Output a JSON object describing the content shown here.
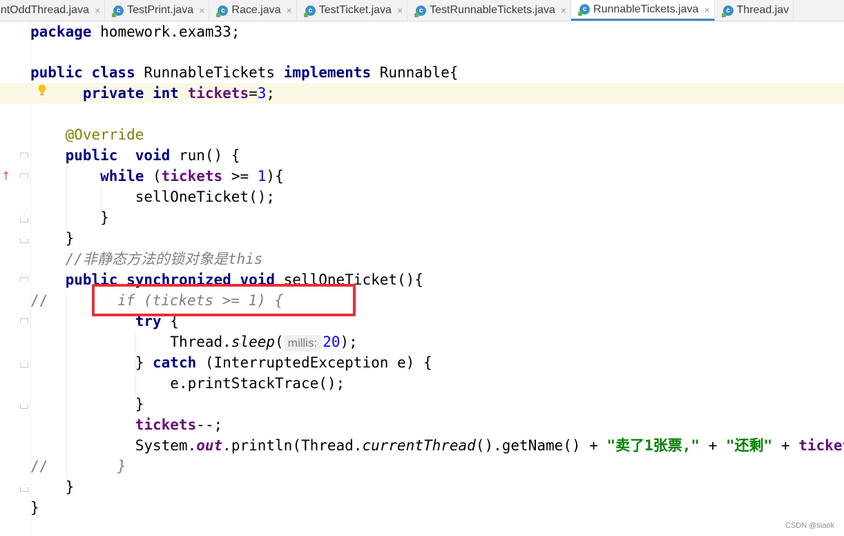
{
  "tabs": [
    {
      "label": "rintOddThread.java",
      "icon": "java-class-icon",
      "active": false
    },
    {
      "label": "TestPrint.java",
      "icon": "java-class-icon",
      "active": false
    },
    {
      "label": "Race.java",
      "icon": "java-class-icon",
      "active": false
    },
    {
      "label": "TestTicket.java",
      "icon": "java-class-icon",
      "active": false
    },
    {
      "label": "TestRunnableTickets.java",
      "icon": "java-class-icon",
      "active": false
    },
    {
      "label": "RunnableTickets.java",
      "icon": "java-class-icon",
      "active": true
    },
    {
      "label": "Thread.jav",
      "icon": "java-class-icon",
      "active": false
    }
  ],
  "tab_close_glyph": "×",
  "tab_class_letter": "c",
  "code": {
    "l1": {
      "kw": "package",
      "rest": " homework.exam33;"
    },
    "l3": {
      "kw1": "public class",
      "name": " RunnableTickets ",
      "kw2": "implements",
      "rest": " Runnable{"
    },
    "l4": {
      "kw": "private int",
      "field": "tickets",
      "eq": "=",
      "num": "3",
      "end": ";"
    },
    "l6": {
      "anno": "@Override"
    },
    "l7": {
      "kw": "public  void",
      "rest": " run() {"
    },
    "l8": {
      "kw": "while",
      "p1": " (",
      "field": "tickets",
      "op": " >= ",
      "num": "1",
      "end": "){"
    },
    "l9": {
      "text": "sellOneTicket();"
    },
    "l10": {
      "text": "}"
    },
    "l11": {
      "text": "}"
    },
    "l12": {
      "comment": "//非静态方法的锁对象是this"
    },
    "l13": {
      "kw": "public synchronized void",
      "rest": " sellOneTicket(){"
    },
    "l14": {
      "comment_prefix": "//",
      "comment": "if (tickets >= 1) {"
    },
    "l15": {
      "kw": "try",
      "rest": " {"
    },
    "l16": {
      "pre": "Thread.",
      "method": "sleep",
      "paren": "(",
      "hint": "millis:",
      "num": "20",
      "end": ");"
    },
    "l17": {
      "brace": "} ",
      "kw": "catch",
      "rest": " (InterruptedException e) {"
    },
    "l18": {
      "text": "e.printStackTrace();"
    },
    "l19": {
      "text": "}"
    },
    "l20": {
      "field": "tickets",
      "end": "--;"
    },
    "l21": {
      "pre": "System.",
      "out": "out",
      "mid": ".println(Thread.",
      "method": "currentThread",
      "rest": "().getName() + ",
      "str1": "\"卖了1张票,\"",
      "plus": " + ",
      "str2": "\"还剩\"",
      "plus2": " + ",
      "tail": "ticket"
    },
    "l22": {
      "comment_prefix": "//",
      "comment": "}"
    },
    "l23": {
      "text": "}"
    },
    "l24": {
      "text": "}"
    }
  },
  "watermark": "CSDN @siaok"
}
